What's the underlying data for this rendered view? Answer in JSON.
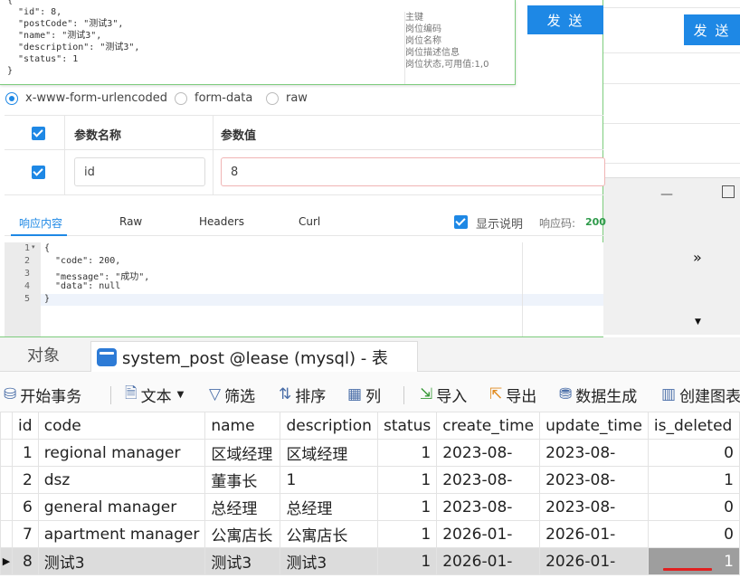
{
  "request_json": {
    "lines": [
      "{",
      "  \"id\": 8,",
      "  \"postCode\": \"测试3\",",
      "  \"name\": \"测试3\",",
      "  \"description\": \"测试3\",",
      "  \"status\": 1",
      "}"
    ],
    "comments": [
      "主键",
      "岗位编码",
      "岗位名称",
      "岗位描述信息",
      "岗位状态,可用值:1,0"
    ]
  },
  "send_label": "发 送",
  "body_types": [
    "x-www-form-urlencoded",
    "form-data",
    "raw"
  ],
  "params": {
    "col_name": "参数名称",
    "col_value": "参数值",
    "rows": [
      {
        "name": "id",
        "value": "8"
      }
    ]
  },
  "response_tabs": [
    "响应内容",
    "Raw",
    "Headers",
    "Curl"
  ],
  "show_desc_label": "显示说明",
  "status_label": "响应码:",
  "status_code": "200",
  "response_lines": [
    {
      "n": "1",
      "t": "{"
    },
    {
      "n": "2",
      "t": "  \"code\": 200,"
    },
    {
      "n": "3",
      "t": "  \"message\": \"成功\","
    },
    {
      "n": "4",
      "t": "  \"data\": null"
    },
    {
      "n": "5",
      "t": "}"
    }
  ],
  "navicat": {
    "objects_tab": "对象",
    "active_tab": "system_post @lease (mysql) - 表",
    "toolbar": {
      "begin_tx": "开始事务",
      "text": "文本",
      "filter": "筛选",
      "sort": "排序",
      "columns": "列",
      "import": "导入",
      "export": "导出",
      "data_gen": "数据生成",
      "create_chart": "创建图表"
    },
    "columns": [
      "id",
      "code",
      "name",
      "description",
      "status",
      "create_time",
      "update_time",
      "is_deleted"
    ],
    "rows": [
      [
        "1",
        "regional manager",
        "区域经理",
        "区域经理",
        "1",
        "2023-08-",
        "2023-08-",
        "0"
      ],
      [
        "2",
        "dsz",
        "董事长",
        "1",
        "1",
        "2023-08-",
        "2023-08-",
        "1"
      ],
      [
        "6",
        "general manager",
        "总经理",
        "总经理",
        "1",
        "2023-08-",
        "2023-08-",
        "0"
      ],
      [
        "7",
        "apartment manager",
        "公寓店长",
        "公寓店长",
        "1",
        "2026-01-",
        "2026-01-",
        "0"
      ],
      [
        "8",
        "测试3",
        "测试3",
        "测试3",
        "1",
        "2026-01-",
        "2026-01-",
        "1"
      ]
    ]
  }
}
